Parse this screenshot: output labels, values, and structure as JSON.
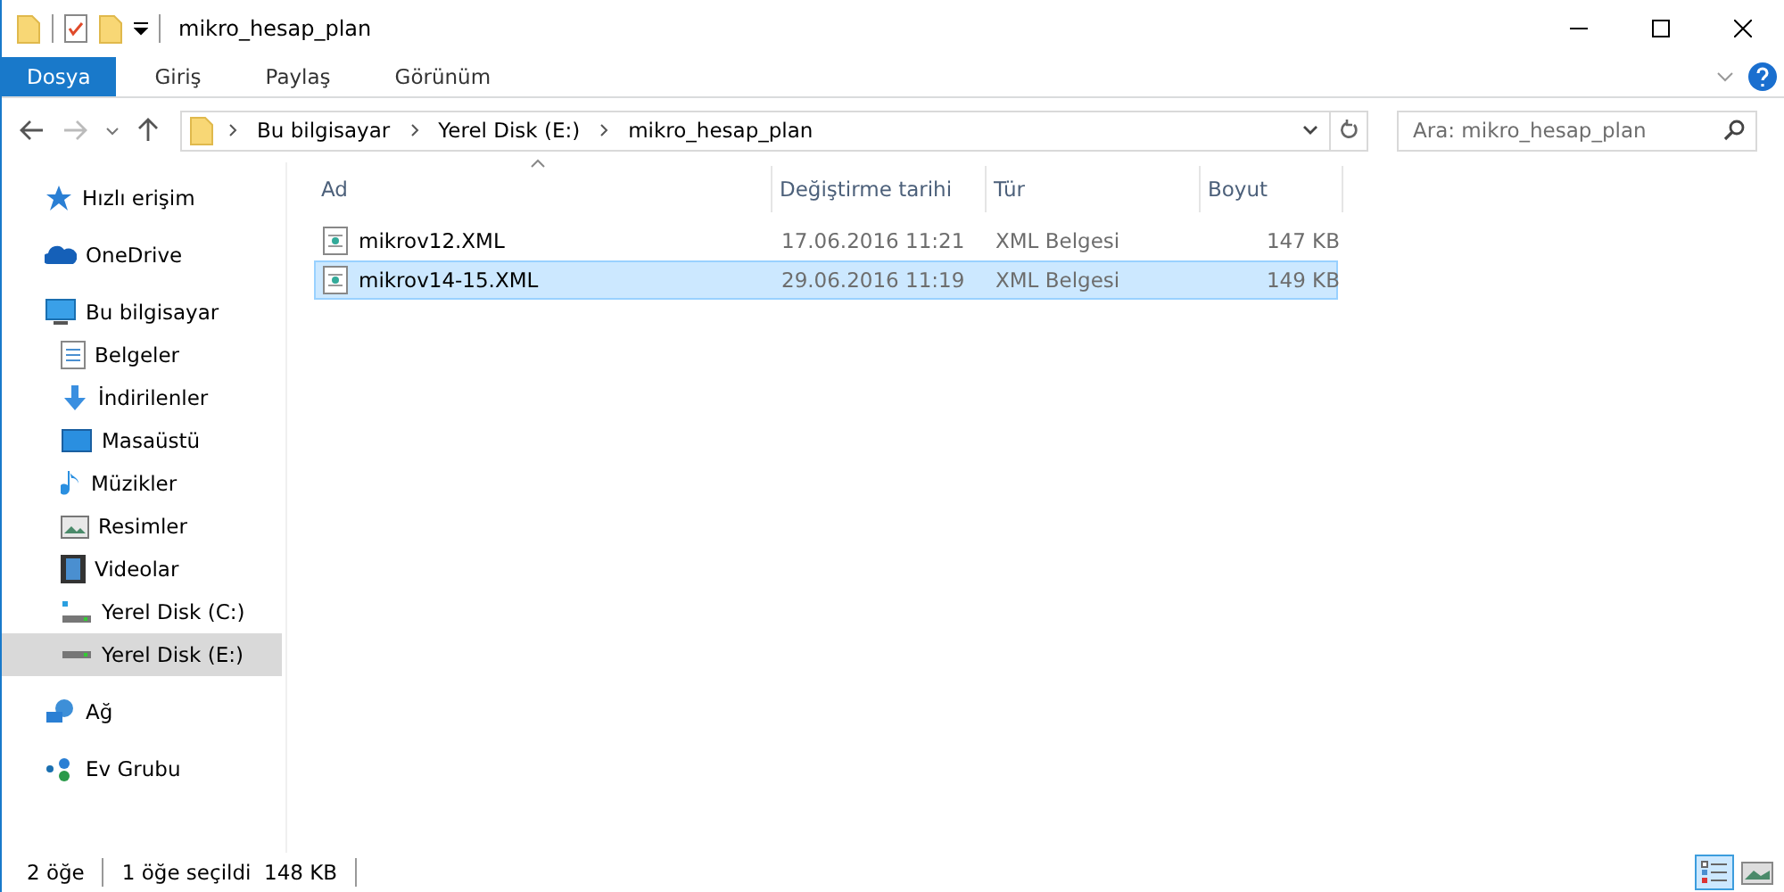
{
  "window": {
    "title": "mikro_hesap_plan"
  },
  "ribbon_tabs": [
    {
      "label": "Dosya",
      "selected": true
    },
    {
      "label": "Giriş",
      "selected": false
    },
    {
      "label": "Paylaş",
      "selected": false
    },
    {
      "label": "Görünüm",
      "selected": false
    }
  ],
  "address": {
    "crumbs": [
      "Bu bilgisayar",
      "Yerel Disk (E:)",
      "mikro_hesap_plan"
    ]
  },
  "search": {
    "placeholder": "Ara: mikro_hesap_plan"
  },
  "sidebar": {
    "items": [
      {
        "label": "Hızlı erişim",
        "selected": false
      },
      {
        "label": "OneDrive",
        "selected": false
      },
      {
        "label": "Bu bilgisayar",
        "selected": false,
        "children": [
          {
            "label": "Belgeler",
            "selected": false
          },
          {
            "label": "İndirilenler",
            "selected": false
          },
          {
            "label": "Masaüstü",
            "selected": false
          },
          {
            "label": "Müzikler",
            "selected": false
          },
          {
            "label": "Resimler",
            "selected": false
          },
          {
            "label": "Videolar",
            "selected": false
          },
          {
            "label": "Yerel Disk (C:)",
            "selected": false
          },
          {
            "label": "Yerel Disk (E:)",
            "selected": true
          }
        ]
      },
      {
        "label": "Ağ",
        "selected": false
      },
      {
        "label": "Ev Grubu",
        "selected": false
      }
    ]
  },
  "table": {
    "columns": [
      "Ad",
      "Değiştirme tarihi",
      "Tür",
      "Boyut"
    ],
    "rows": [
      {
        "name": "mikrov12.XML",
        "date": "17.06.2016 11:21",
        "type": "XML Belgesi",
        "size": "147 KB",
        "selected": false
      },
      {
        "name": "mikrov14-15.XML",
        "date": "29.06.2016 11:19",
        "type": "XML Belgesi",
        "size": "149 KB",
        "selected": true
      }
    ]
  },
  "status_bar": {
    "count": "2 öğe",
    "selection": "1 öğe seçildi  148 KB"
  },
  "view_buttons": [
    {
      "kind": "details",
      "selected": true
    },
    {
      "kind": "thumbnails",
      "selected": false
    }
  ]
}
